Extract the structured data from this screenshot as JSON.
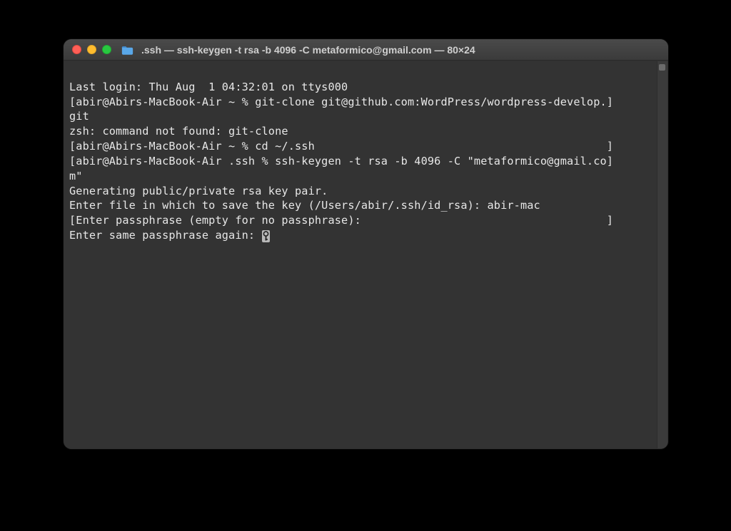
{
  "window": {
    "title": ".ssh — ssh-keygen -t rsa -b 4096 -C metaformico@gmail.com — 80×24"
  },
  "lines": {
    "l0": "Last login: Thu Aug  1 04:32:01 on ttys000",
    "l1_open": "[",
    "l1_body": "abir@Abirs-MacBook-Air ~ % git-clone git@github.com:WordPress/wordpress-develop.",
    "l1_close": "]",
    "l2": "git",
    "l3": "zsh: command not found: git-clone",
    "l4_open": "[",
    "l4_body": "abir@Abirs-MacBook-Air ~ % cd ~/.ssh                                            ",
    "l4_close": "]",
    "l5_open": "[",
    "l5_body": "abir@Abirs-MacBook-Air .ssh % ssh-keygen -t rsa -b 4096 -C \"metaformico@gmail.co",
    "l5_close": "]",
    "l6": "m\"",
    "l7": "Generating public/private rsa key pair.",
    "l8": "Enter file in which to save the key (/Users/abir/.ssh/id_rsa): abir-mac",
    "l9_open": "[",
    "l9_body": "Enter passphrase (empty for no passphrase):                                     ",
    "l9_close": "]",
    "l10": "Enter same passphrase again: "
  }
}
